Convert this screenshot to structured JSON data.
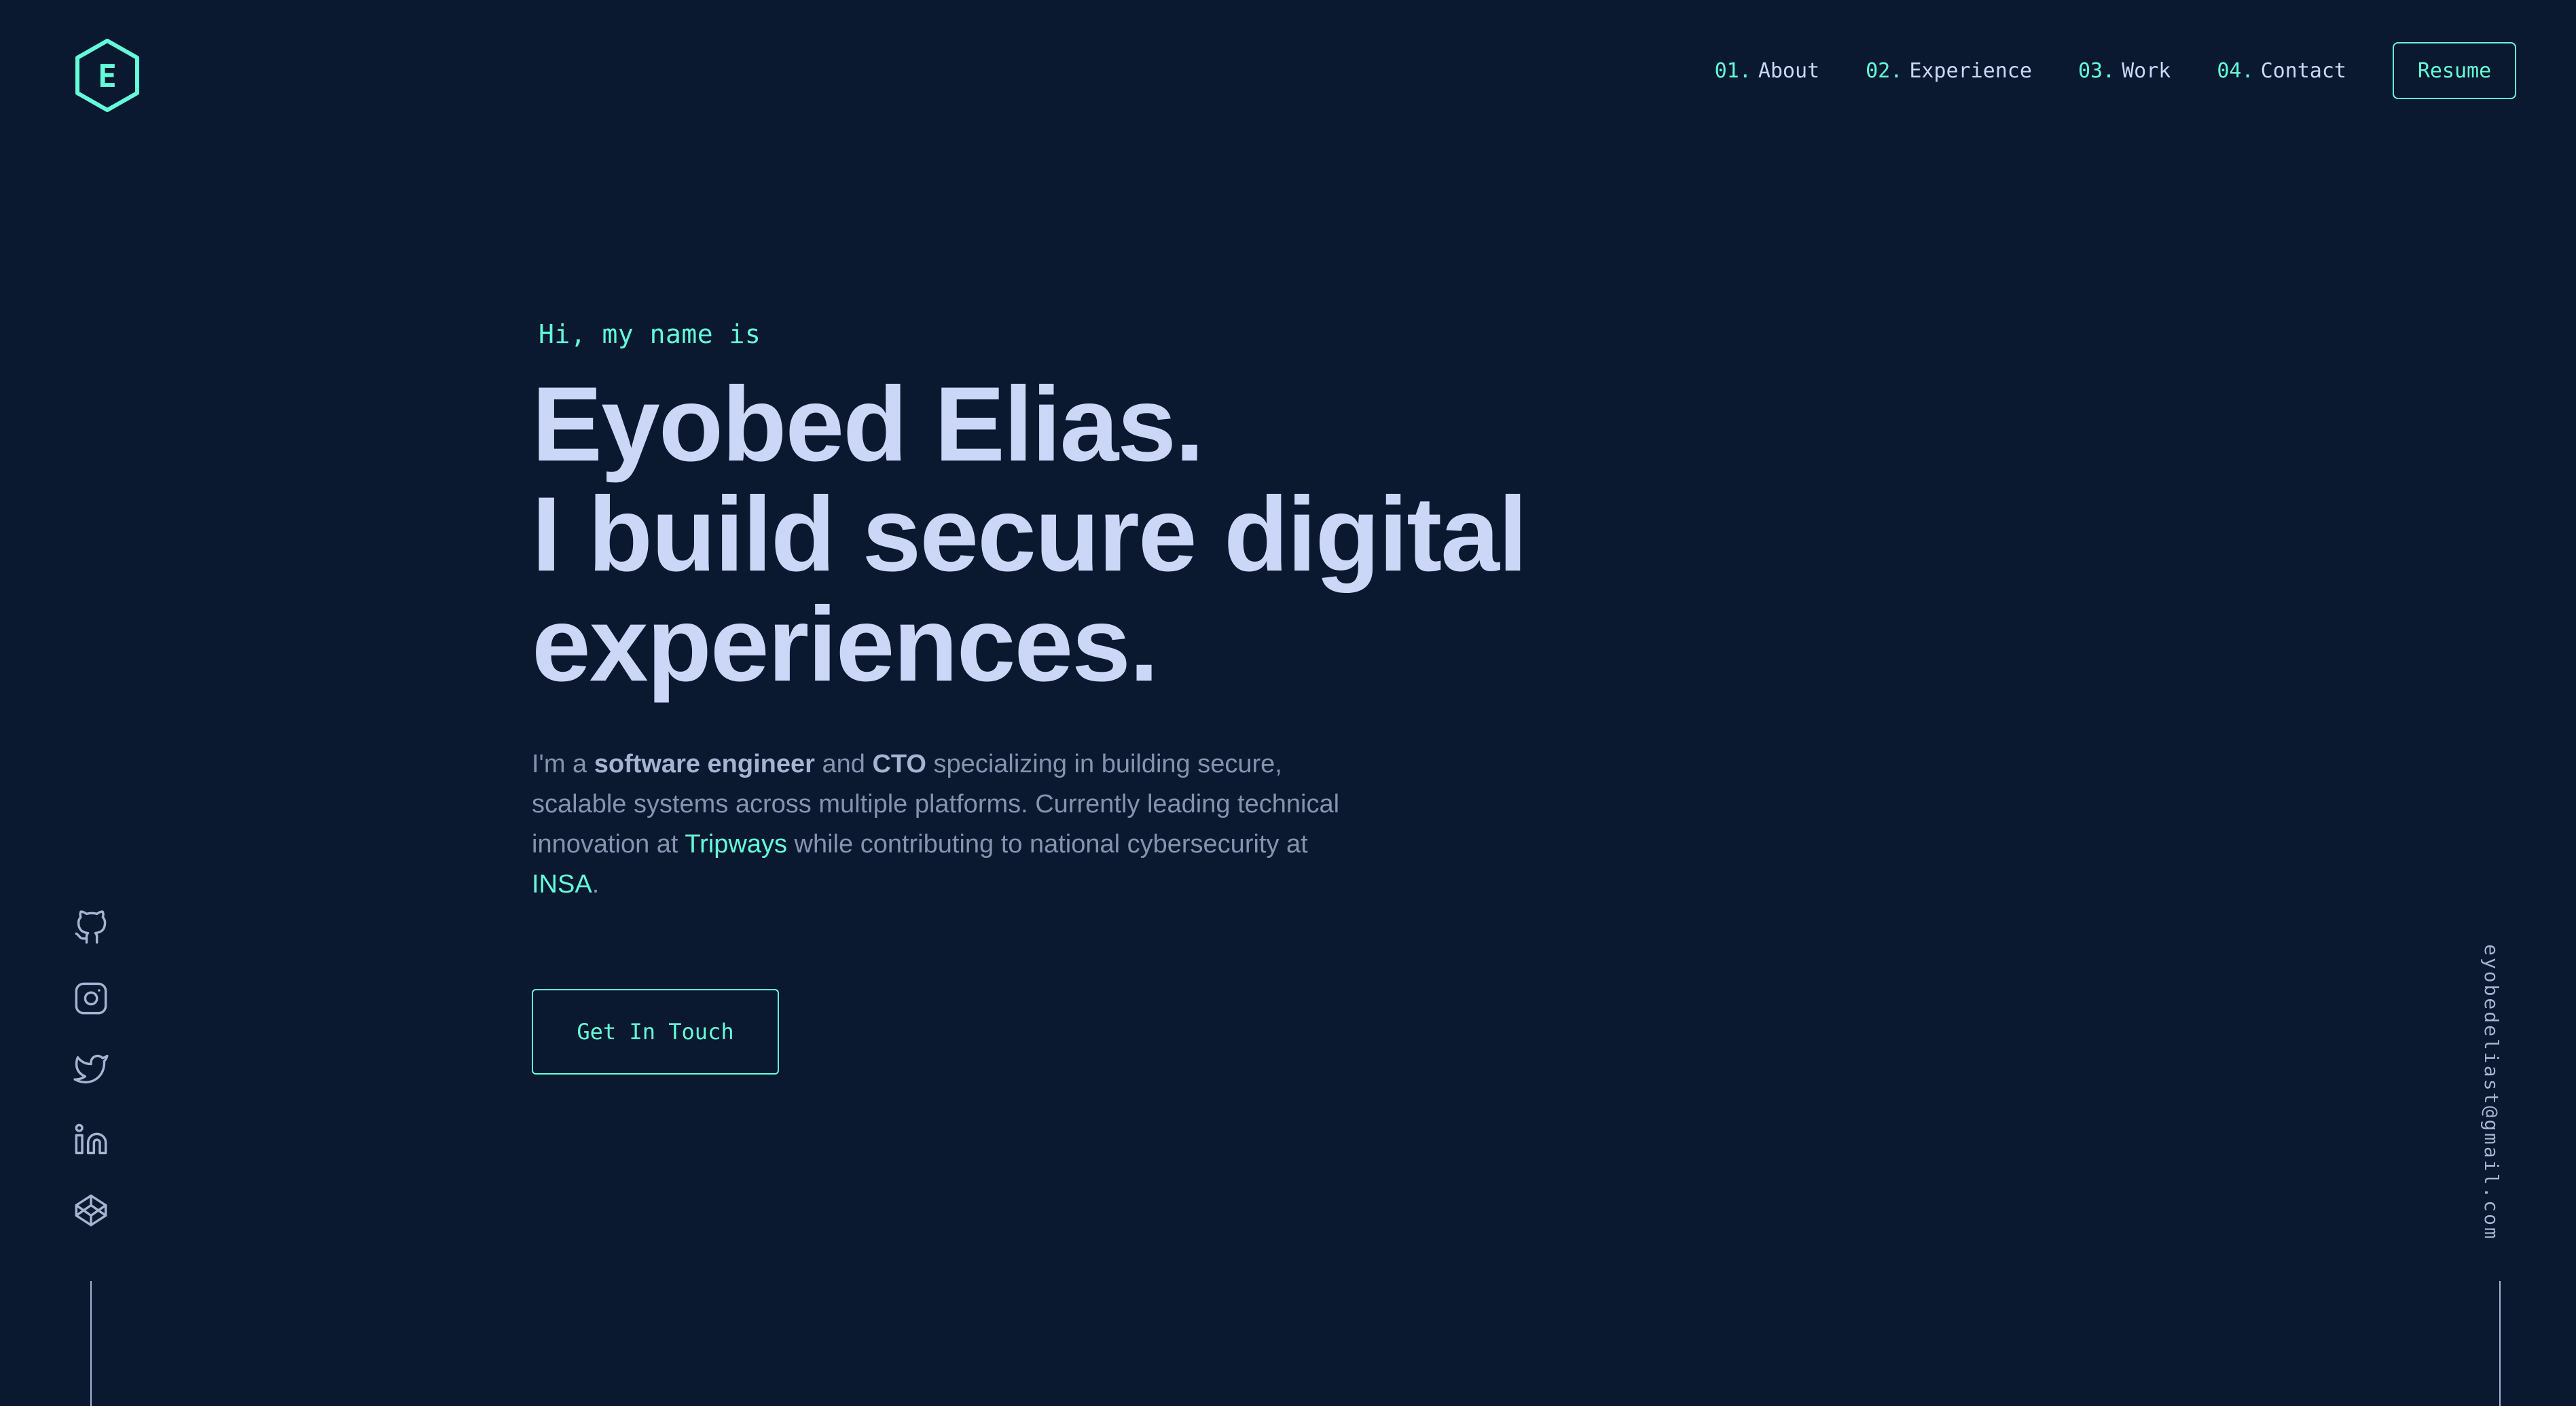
{
  "logo": {
    "letter": "E"
  },
  "nav": {
    "items": [
      {
        "num": "01.",
        "label": "About"
      },
      {
        "num": "02.",
        "label": "Experience"
      },
      {
        "num": "03.",
        "label": "Work"
      },
      {
        "num": "04.",
        "label": "Contact"
      }
    ],
    "resume_label": "Resume"
  },
  "hero": {
    "greeting": "Hi, my name is",
    "name": "Eyobed Elias.",
    "tagline_line1": "I build secure digital",
    "tagline_line2": "experiences.",
    "intro": {
      "part1": "I'm a ",
      "bold1": "software engineer",
      "part2": " and ",
      "bold2": "CTO",
      "part3": " specializing in building secure, scalable systems across multiple platforms. Currently leading technical innovation at ",
      "link1": "Tripways",
      "part4": " while contributing to national cybersecurity at ",
      "link2": "INSA",
      "part5": "."
    },
    "cta_label": "Get In Touch"
  },
  "socials": [
    "github-icon",
    "instagram-icon",
    "twitter-icon",
    "linkedin-icon",
    "codepen-icon"
  ],
  "email": "eyobedeliast@gmail.com",
  "colors": {
    "background": "#0a192f",
    "accent": "#64ffda",
    "heading": "#ccd6f6",
    "body": "#8892b0"
  }
}
